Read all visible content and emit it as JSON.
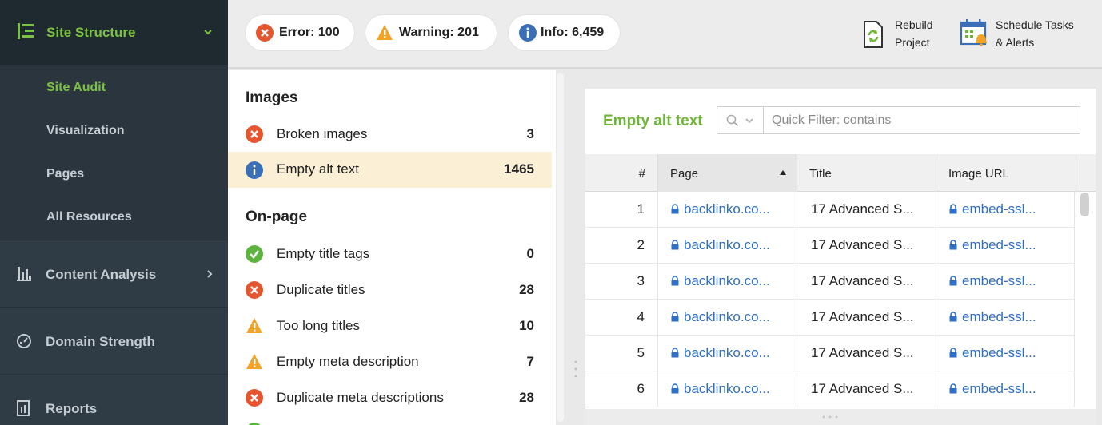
{
  "colors": {
    "accent_green": "#7cc242",
    "error_red": "#e4562f",
    "warning_orange": "#f4a324",
    "info_blue": "#3a6fb8",
    "ok_green": "#5cb33d",
    "link_blue": "#2f6fc4"
  },
  "sidebar": {
    "header": {
      "label": "Site Structure",
      "icon": "list-icon"
    },
    "subitems": [
      {
        "label": "Site Audit",
        "active": true
      },
      {
        "label": "Visualization",
        "active": false
      },
      {
        "label": "Pages",
        "active": false
      },
      {
        "label": "All Resources",
        "active": false
      }
    ],
    "sections": [
      {
        "label": "Content Analysis",
        "icon": "bar-chart-icon",
        "has_chevron": true
      },
      {
        "label": "Domain Strength",
        "icon": "gauge-icon",
        "has_chevron": false
      },
      {
        "label": "Reports",
        "icon": "report-icon",
        "has_chevron": false
      }
    ]
  },
  "topbar": {
    "error_label": "Error: 100",
    "warning_label": "Warning: 201",
    "info_label": "Info: 6,459",
    "rebuild": {
      "line1": "Rebuild",
      "line2": "Project"
    },
    "schedule": {
      "line1": "Schedule Tasks",
      "line2": "& Alerts"
    }
  },
  "issues": {
    "groups": [
      {
        "title": "Images",
        "items": [
          {
            "label": "Broken images",
            "count": "3",
            "status": "error"
          },
          {
            "label": "Empty alt text",
            "count": "1465",
            "status": "info",
            "selected": true
          }
        ]
      },
      {
        "title": "On-page",
        "items": [
          {
            "label": "Empty title tags",
            "count": "0",
            "status": "ok"
          },
          {
            "label": "Duplicate titles",
            "count": "28",
            "status": "error"
          },
          {
            "label": "Too long titles",
            "count": "10",
            "status": "warning"
          },
          {
            "label": "Empty meta description",
            "count": "7",
            "status": "warning"
          },
          {
            "label": "Duplicate meta descriptions",
            "count": "28",
            "status": "error"
          }
        ]
      }
    ]
  },
  "detail": {
    "title": "Empty alt text",
    "filter_placeholder": "Quick Filter: contains",
    "columns": [
      "#",
      "Page",
      "Title",
      "Image URL"
    ],
    "rows": [
      {
        "num": "1",
        "page": "backlinko.co...",
        "title": "17 Advanced S...",
        "image_url": "embed-ssl..."
      },
      {
        "num": "2",
        "page": "backlinko.co...",
        "title": "17 Advanced S...",
        "image_url": "embed-ssl..."
      },
      {
        "num": "3",
        "page": "backlinko.co...",
        "title": "17 Advanced S...",
        "image_url": "embed-ssl..."
      },
      {
        "num": "4",
        "page": "backlinko.co...",
        "title": "17 Advanced S...",
        "image_url": "embed-ssl..."
      },
      {
        "num": "5",
        "page": "backlinko.co...",
        "title": "17 Advanced S...",
        "image_url": "embed-ssl..."
      },
      {
        "num": "6",
        "page": "backlinko.co...",
        "title": "17 Advanced S...",
        "image_url": "embed-ssl..."
      }
    ]
  }
}
